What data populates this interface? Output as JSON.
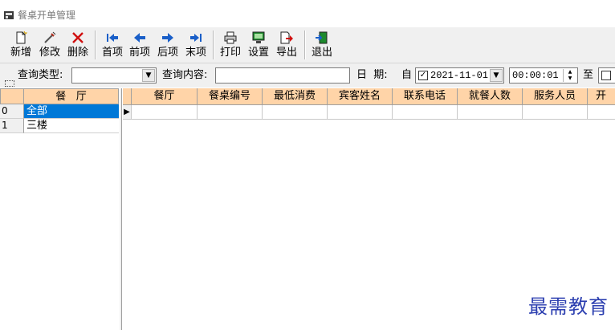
{
  "window": {
    "title": "餐桌开单管理"
  },
  "toolbar": {
    "new": "新增",
    "edit": "修改",
    "delete": "删除",
    "first": "首项",
    "prev": "前项",
    "next": "后项",
    "last": "末项",
    "print": "打印",
    "settings": "设置",
    "export": "导出",
    "exit": "退出"
  },
  "query": {
    "type_label": "查询类型:",
    "type_value": "",
    "content_label": "查询内容:",
    "content_value": "",
    "date_label": "日  期:",
    "from_label": "自",
    "date_checked": true,
    "date_value": "2021-11-01",
    "time_value": "00:00:01",
    "to_label": "至"
  },
  "left_panel": {
    "header": "餐   厅",
    "rows": [
      {
        "num": "0",
        "name": "全部",
        "selected": true
      },
      {
        "num": "1",
        "name": "三楼",
        "selected": false
      }
    ]
  },
  "grid": {
    "columns": [
      "餐厅",
      "餐桌编号",
      "最低消费",
      "宾客姓名",
      "联系电话",
      "就餐人数",
      "服务人员",
      "开"
    ],
    "row_indicator": "▶"
  },
  "colors": {
    "header_bg": "#ffd4a8",
    "selected_bg": "#0078d7",
    "watermark": "#2c3fb0"
  },
  "watermark": "最需教育"
}
